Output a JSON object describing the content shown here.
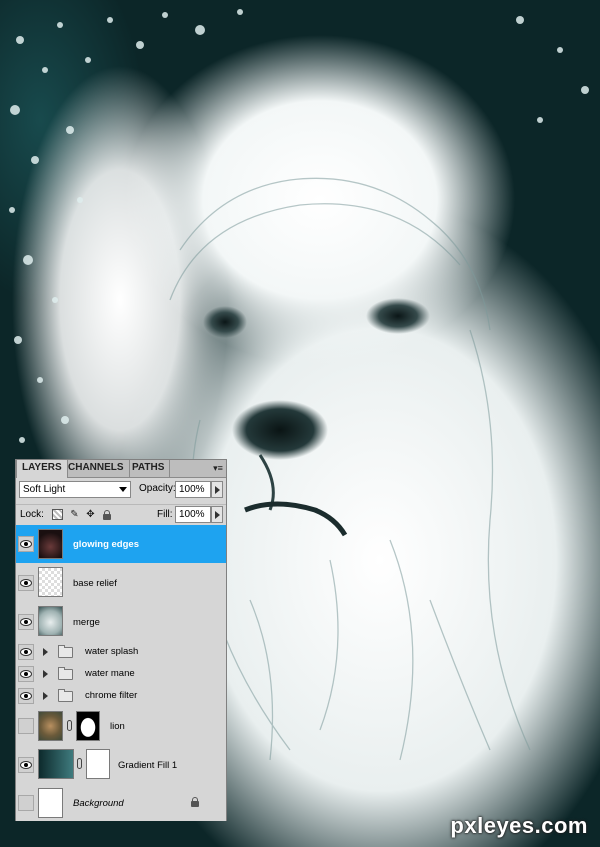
{
  "panel": {
    "tabs": [
      {
        "label": "LAYERS",
        "active": true
      },
      {
        "label": "CHANNELS",
        "active": false
      },
      {
        "label": "PATHS",
        "active": false
      }
    ],
    "blend_mode": "Soft Light",
    "opacity_label": "Opacity:",
    "opacity_value": "100%",
    "lock_label": "Lock:",
    "fill_label": "Fill:",
    "fill_value": "100%"
  },
  "layers": [
    {
      "name": "glowing edges",
      "visible": true,
      "selected": true,
      "type": "raster-dark"
    },
    {
      "name": "base  relief",
      "visible": true,
      "selected": false,
      "type": "raster-transparent"
    },
    {
      "name": "merge",
      "visible": true,
      "selected": false,
      "type": "raster-image"
    },
    {
      "name": "water splash",
      "visible": true,
      "selected": false,
      "type": "group"
    },
    {
      "name": "water mane",
      "visible": true,
      "selected": false,
      "type": "group"
    },
    {
      "name": "chrome filter",
      "visible": true,
      "selected": false,
      "type": "group"
    },
    {
      "name": "lion",
      "visible": false,
      "selected": false,
      "type": "masked-image"
    },
    {
      "name": "Gradient Fill 1",
      "visible": true,
      "selected": false,
      "type": "gradient-fill"
    },
    {
      "name": "Background",
      "visible": false,
      "selected": false,
      "type": "background",
      "locked": true
    }
  ],
  "watermark": "pxleyes.com",
  "colors": {
    "selection": "#1ea3f0",
    "panel_bg": "#d6d6d6",
    "artwork_dark": "#0d2a2c"
  }
}
